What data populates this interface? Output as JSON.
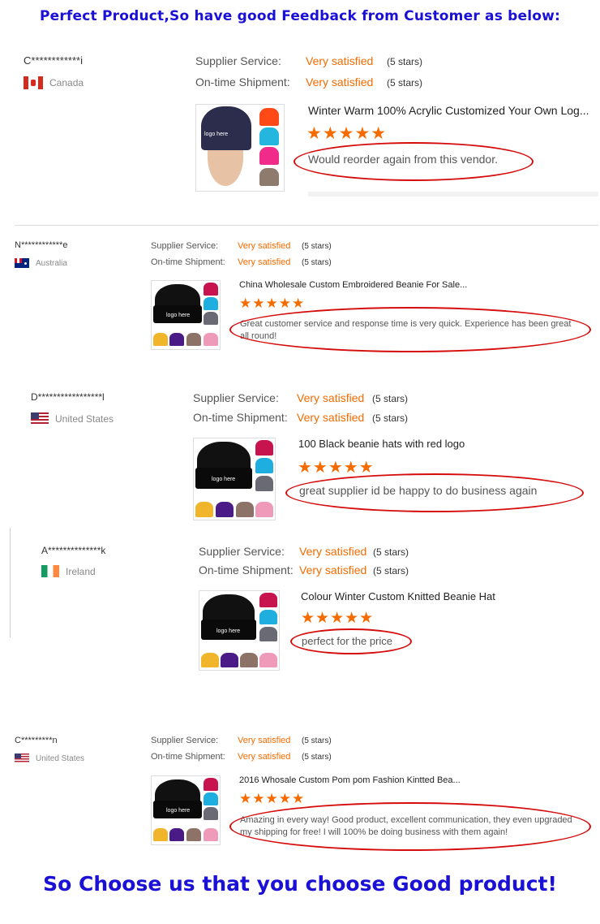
{
  "header": {
    "title": "Perfect Product,So have good Feedback from Customer as below:"
  },
  "footer": {
    "slogan": "So Choose us that you choose Good product!"
  },
  "labels": {
    "supplier_service": "Supplier Service:",
    "ontime_shipment": "On-time Shipment:"
  },
  "reviews": [
    {
      "buyer": "C************i",
      "country": "Canada",
      "supplier_rating": "Very satisfied",
      "supplier_stars": "(5 stars)",
      "shipment_rating": "Very satisfied",
      "shipment_stars": "(5 stars)",
      "product_title": "Winter Warm 100% Acrylic Customized Your Own Log...",
      "stars": "★★★★★",
      "comment": "Would reorder again from this vendor.",
      "thumb_logo_text": "logo here"
    },
    {
      "buyer": "N************e",
      "country": "Australia",
      "supplier_rating": "Very satisfied",
      "supplier_stars": "(5 stars)",
      "shipment_rating": "Very satisfied",
      "shipment_stars": "(5 stars)",
      "product_title": "China Wholesale Custom Embroidered Beanie For Sale...",
      "stars": "★★★★★",
      "comment": "Great customer service and response time is very quick. Experience has been great all round!",
      "thumb_logo_text": "logo here"
    },
    {
      "buyer": "D*****************l",
      "country": "United States",
      "supplier_rating": "Very satisfied",
      "supplier_stars": "(5 stars)",
      "shipment_rating": "Very satisfied",
      "shipment_stars": "(5 stars)",
      "product_title": "100 Black beanie hats with red logo",
      "stars": "★★★★★",
      "comment": "great supplier id be happy to do business again",
      "thumb_logo_text": "logo here"
    },
    {
      "buyer": "A**************k",
      "country": "Ireland",
      "supplier_rating": "Very satisfied",
      "supplier_stars": "(5 stars)",
      "shipment_rating": "Very satisfied",
      "shipment_stars": "(5 stars)",
      "product_title": "Colour Winter Custom Knitted Beanie Hat",
      "stars": "★★★★★",
      "comment": "perfect for the price",
      "thumb_logo_text": "logo here"
    },
    {
      "buyer": "C*********n",
      "country": "United States",
      "supplier_rating": "Very satisfied",
      "supplier_stars": "(5 stars)",
      "shipment_rating": "Very satisfied",
      "shipment_stars": "(5 stars)",
      "product_title": "2016 Whosale Custom Pom pom Fashion Kintted Bea...",
      "stars": "★★★★★",
      "comment": "Amazing in every way! Good product, excellent communication, they even upgraded my shipping for free! I will 100% be doing business with them again!",
      "thumb_logo_text": "logo here"
    }
  ],
  "colors": {
    "headline": "#1a10d6",
    "rating": "#f56b00",
    "stars": "#f56b00",
    "highlight_ellipse": "#d60c0c"
  }
}
